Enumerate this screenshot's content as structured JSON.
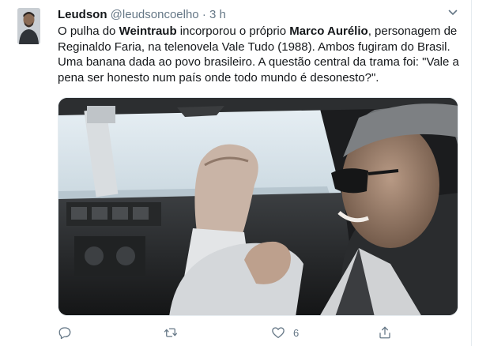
{
  "tweet": {
    "author_name": "Leudson",
    "author_handle": "@leudsoncoelho",
    "separator": "·",
    "time": "3 h",
    "text_parts": [
      "O pulha do ",
      "Weintraub",
      " incorporou o próprio ",
      "Marco Aurélio",
      ", personagem de Reginaldo Faria, na telenovela Vale Tudo (1988). Ambos fugiram do Brasil. Uma banana dada ao povo brasileiro. A questão central da trama foi: \"Vale a pena ser honesto num país onde todo mundo é desonesto?\"."
    ],
    "actions": {
      "reply": {
        "icon": "reply-icon",
        "count": ""
      },
      "retweet": {
        "icon": "retweet-icon",
        "count": ""
      },
      "like": {
        "icon": "heart-icon",
        "count": "6"
      },
      "share": {
        "icon": "share-icon",
        "count": ""
      }
    }
  },
  "colors": {
    "text": "#14171a",
    "secondary": "#657786",
    "border": "#e6ecf0"
  }
}
